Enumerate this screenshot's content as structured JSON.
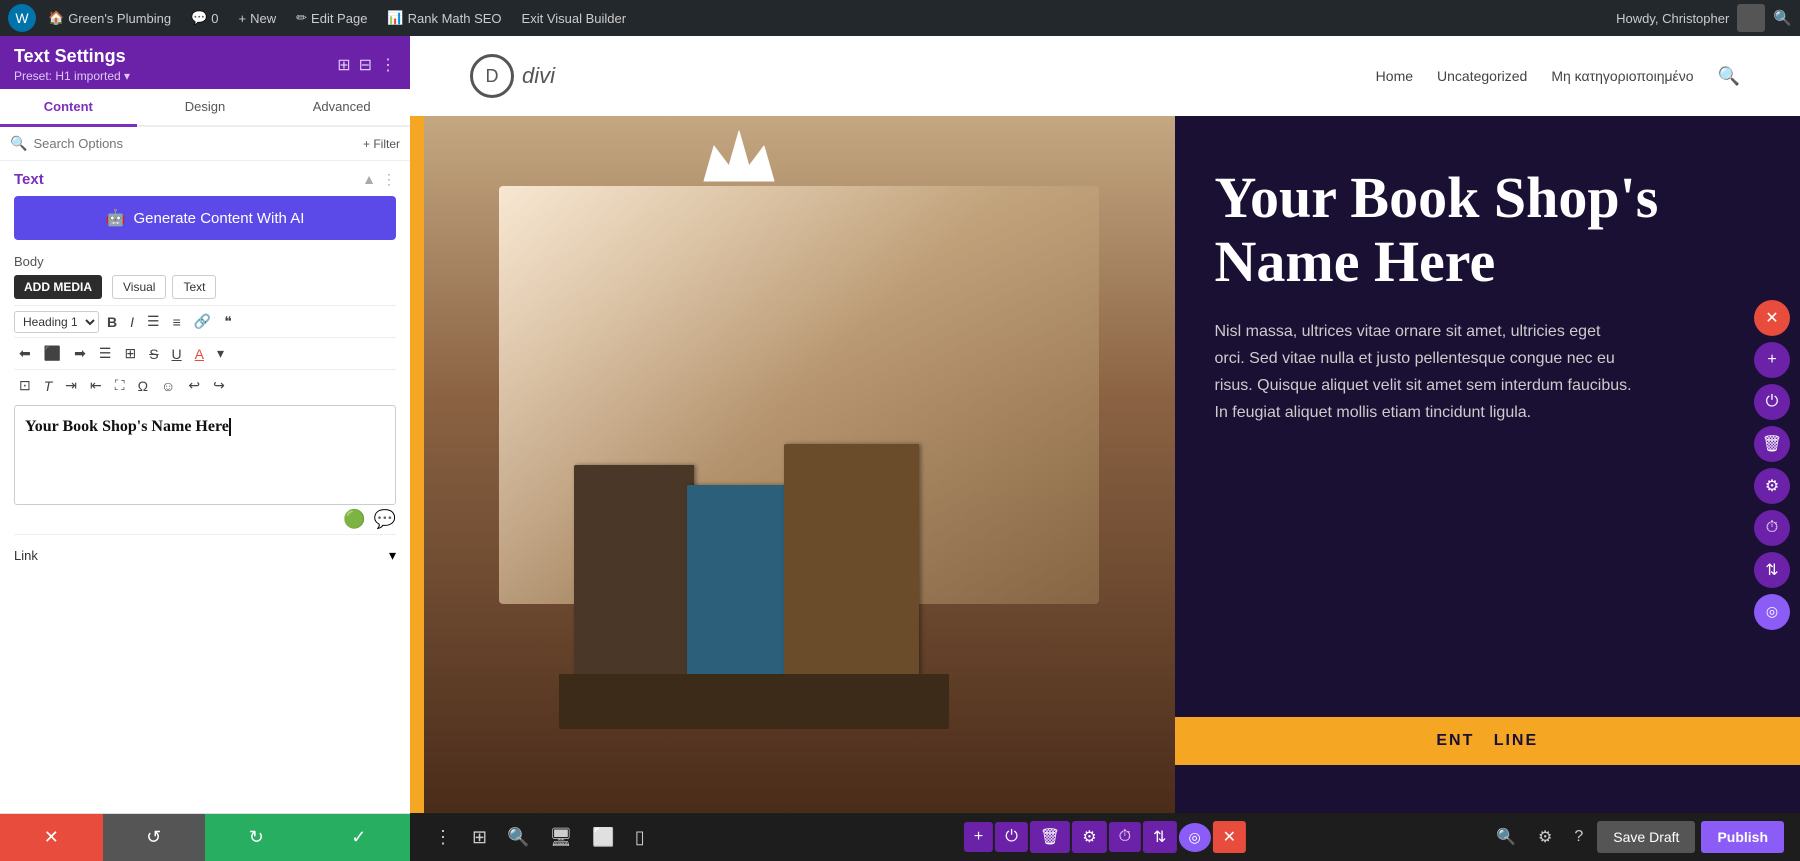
{
  "topbar": {
    "wp_label": "W",
    "site_name": "Green's Plumbing",
    "comments_label": "0",
    "new_label": "New",
    "edit_page_label": "Edit Page",
    "rank_math_label": "Rank Math SEO",
    "exit_label": "Exit Visual Builder",
    "howdy": "Howdy, Christopher"
  },
  "panel": {
    "title": "Text Settings",
    "preset": "Preset: H1 imported ▾",
    "tabs": [
      {
        "id": "content",
        "label": "Content",
        "active": true
      },
      {
        "id": "design",
        "label": "Design",
        "active": false
      },
      {
        "id": "advanced",
        "label": "Advanced",
        "active": false
      }
    ],
    "search_placeholder": "Search Options",
    "filter_label": "+ Filter",
    "sections": {
      "text": {
        "title": "Text",
        "ai_btn": "Generate Content With AI",
        "body_label": "Body",
        "add_media": "ADD MEDIA",
        "visual_label": "Visual",
        "text_label": "Text",
        "heading_select": "Heading 1",
        "editor_content": "Your Book Shop's Name Here",
        "link_label": "Link"
      }
    },
    "footer": {
      "cancel_icon": "✕",
      "undo_icon": "↺",
      "redo_icon": "↻",
      "confirm_icon": "✓"
    }
  },
  "site_header": {
    "logo_letter": "D",
    "logo_name": "divi",
    "nav_items": [
      "Home",
      "Uncategorized",
      "Μη κατηγοριοποιημένο"
    ]
  },
  "hero": {
    "heading": "Your Book Shop's Name Here",
    "body_text": "Nisl massa, ultrices vitae ornare sit amet, ultricies eget orci. Sed vitae nulla et justo pellentesque congue nec eu risus. Quisque aliquet velit sit amet sem interdum faucibus. In feugiat aliquet mollis etiam tincidunt ligula.",
    "cta_text": "ENT LINE"
  },
  "bottom_bar": {
    "tools_left": [
      "⋮",
      "⊞",
      "🔍",
      "▭",
      "⬜",
      "▯"
    ],
    "center_plus": "+",
    "center_power": "⏻",
    "center_trash": "🗑",
    "center_gear": "⚙",
    "center_clock": "⏱",
    "center_layers": "⇅",
    "center_move": "◎",
    "center_close": "✕",
    "right_search": "🔍",
    "right_settings": "⚙",
    "right_help": "?",
    "save_draft": "Save Draft",
    "publish": "Publish"
  },
  "icons": {
    "wp": "W",
    "bubble": "💬",
    "pencil": "✏",
    "bar_chart": "📊",
    "chevron_down": "▾",
    "collapse": "▲",
    "more_vert": "⋮",
    "bold": "B",
    "italic": "I",
    "ul": "☰",
    "ol": "≡",
    "link_icon": "🔗",
    "quote": "❝",
    "align_left": "≡",
    "align_center": "≡",
    "align_right": "≡",
    "align_justify": "≡",
    "table": "⊞",
    "strikethrough": "S̶",
    "underline": "U",
    "color": "A",
    "clear_format": "T",
    "indent": "→",
    "outdent": "←",
    "fullscreen": "⛶",
    "special_char": "Ω",
    "emoji": "☺",
    "undo_editor": "↩",
    "redo_editor": "↪",
    "green_icon": "🟢",
    "chat_icon": "💬"
  }
}
